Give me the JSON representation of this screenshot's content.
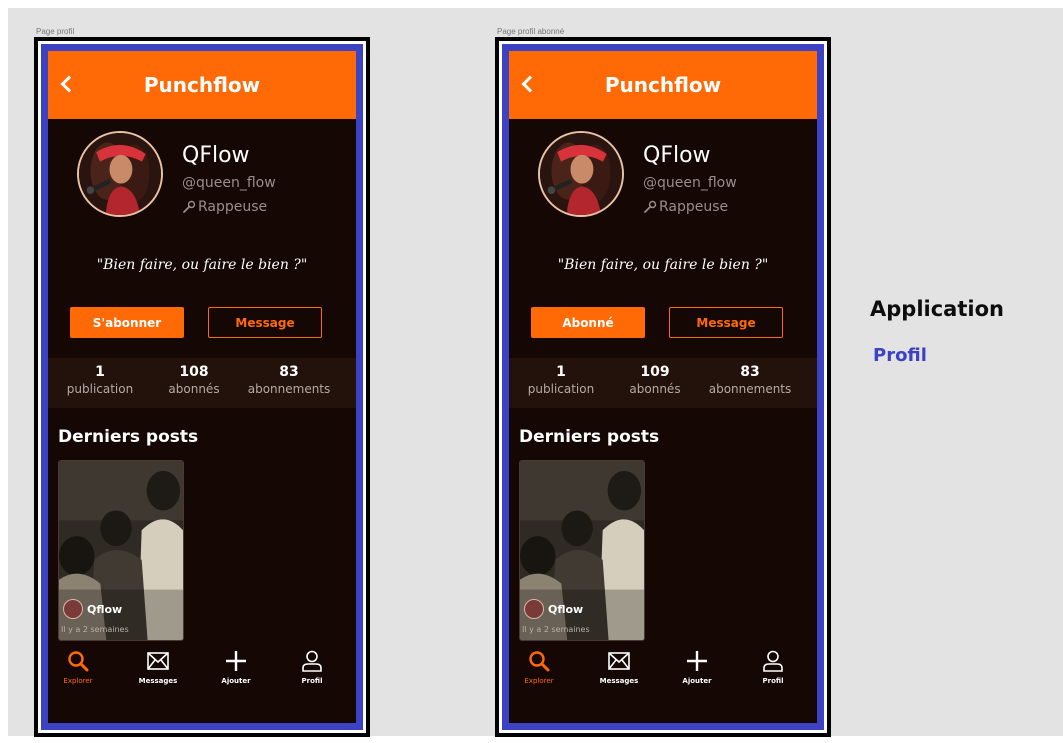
{
  "screens": [
    {
      "frame_label": "Page profil",
      "header": {
        "title": "Punchflow"
      },
      "profile": {
        "name": "QFlow",
        "handle": "@queen_flow",
        "role": "Rappeuse",
        "quote": "\"Bien faire, ou faire le bien ?\""
      },
      "actions": {
        "primary": "S'abonner",
        "secondary": "Message"
      },
      "stats": [
        {
          "value": "1",
          "label": "publication"
        },
        {
          "value": "108",
          "label": "abonnés"
        },
        {
          "value": "83",
          "label": "abonnements"
        }
      ],
      "section_title": "Derniers posts",
      "post": {
        "author": "Qflow",
        "time": "Il y a 2 semaines"
      },
      "tabs": [
        {
          "label": "Explorer",
          "icon": "search-icon",
          "active": true
        },
        {
          "label": "Messages",
          "icon": "envelope-icon"
        },
        {
          "label": "Ajouter",
          "icon": "plus-icon"
        },
        {
          "label": "Profil",
          "icon": "user-icon"
        }
      ]
    },
    {
      "frame_label": "Page profil abonné",
      "header": {
        "title": "Punchflow"
      },
      "profile": {
        "name": "QFlow",
        "handle": "@queen_flow",
        "role": "Rappeuse",
        "quote": "\"Bien faire, ou faire le bien ?\""
      },
      "actions": {
        "primary": "Abonné",
        "secondary": "Message"
      },
      "stats": [
        {
          "value": "1",
          "label": "publication"
        },
        {
          "value": "109",
          "label": "abonnés"
        },
        {
          "value": "83",
          "label": "abonnements"
        }
      ],
      "section_title": "Derniers posts",
      "post": {
        "author": "Qflow",
        "time": "Il y a 2 semaines"
      },
      "tabs": [
        {
          "label": "Explorer",
          "icon": "search-icon",
          "active": true
        },
        {
          "label": "Messages",
          "icon": "envelope-icon"
        },
        {
          "label": "Ajouter",
          "icon": "plus-icon"
        },
        {
          "label": "Profil",
          "icon": "user-icon"
        }
      ]
    }
  ],
  "side": {
    "title": "Application",
    "subtitle": "Profil"
  },
  "colors": {
    "accent": "#ff6a06",
    "frame": "#3c42c2",
    "screen_bg": "#140704",
    "page_bg": "#e3e3e3"
  }
}
